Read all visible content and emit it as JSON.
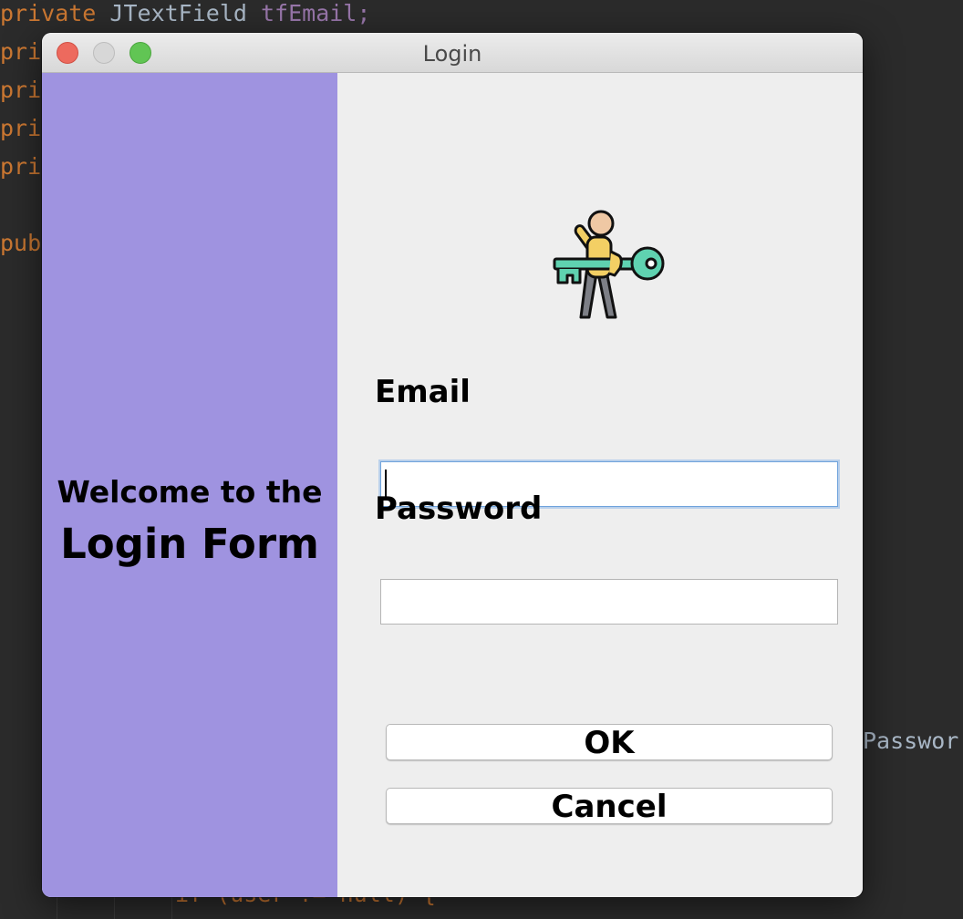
{
  "editor": {
    "line1": {
      "kw": "private",
      "type": "JTextField",
      "field": "tfEmail;"
    },
    "line2": "pri",
    "line3": "pri",
    "line4": "pri",
    "line5": "pri",
    "line6": "pub",
    "right_fragment": "Passwor",
    "bottom_fragment": "if (user != null) {"
  },
  "window": {
    "title": "Login"
  },
  "left_panel": {
    "welcome_line1": "Welcome to the",
    "welcome_line2": "Login Form",
    "background": "#9f93e0"
  },
  "form": {
    "illustration_icon": "user-with-key-icon",
    "email_label": "Email",
    "email_value": "",
    "password_label": "Password",
    "password_value": "",
    "ok_label": "OK",
    "cancel_label": "Cancel"
  },
  "colors": {
    "keyword": "#cc7832",
    "field": "#9876aa",
    "focus": "#6fa3dc"
  }
}
